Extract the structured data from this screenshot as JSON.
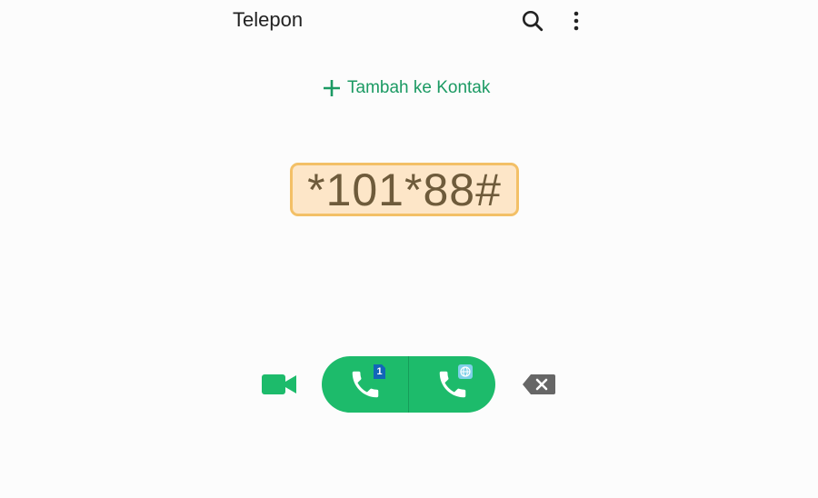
{
  "header": {
    "title": "Telepon",
    "search_icon": "search-icon",
    "more_icon": "more-vert-icon"
  },
  "add_contact": {
    "label": "Tambah ke Kontak",
    "icon": "plus-icon"
  },
  "dialer": {
    "number": "*101*88#"
  },
  "actions": {
    "video_icon": "video-call-icon",
    "call_sim1": {
      "icon": "phone-icon",
      "badge": "1"
    },
    "call_wifi": {
      "icon": "phone-icon",
      "badge_icon": "globe-icon"
    },
    "backspace_icon": "backspace-icon"
  },
  "colors": {
    "accent": "#1b9a63",
    "call_green": "#1dbb6b",
    "number_highlight_bg": "#fde6c8",
    "number_highlight_border": "#f3c067",
    "number_text": "#6e5b3b",
    "sim_badge": "#1266b8"
  }
}
